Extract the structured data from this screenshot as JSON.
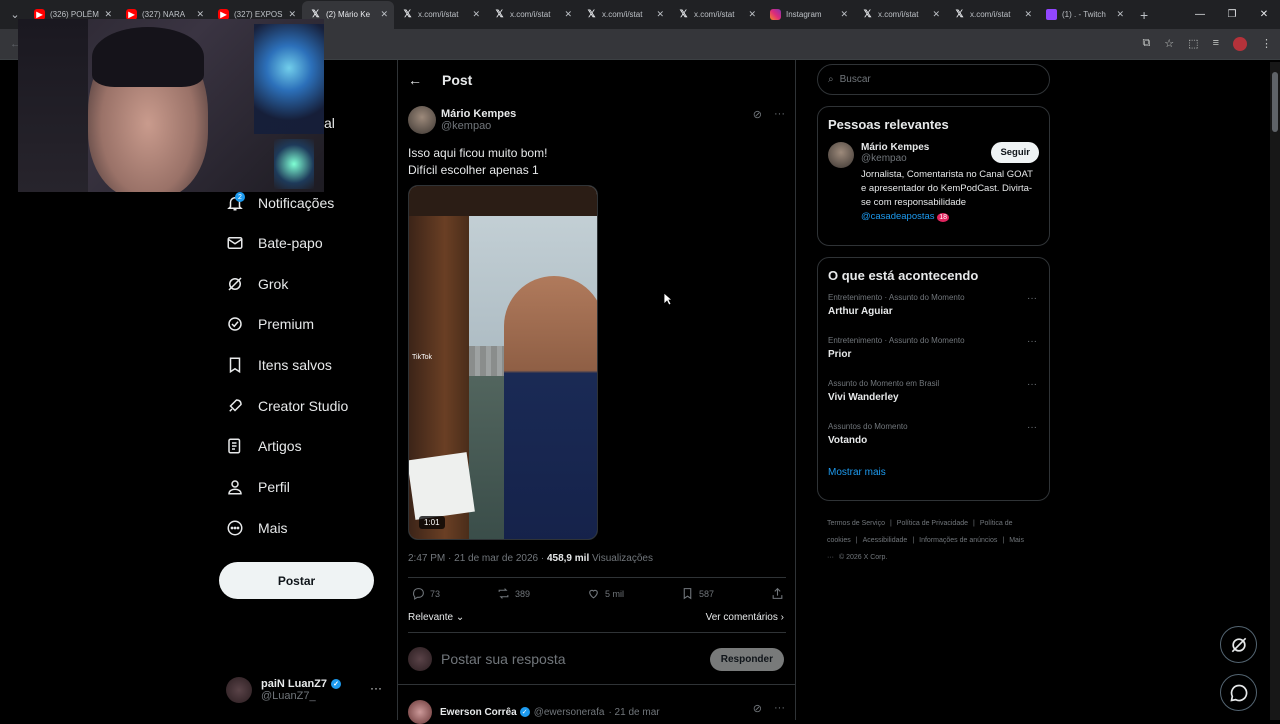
{
  "browser": {
    "tabs": [
      {
        "title": "(326) POLÊM",
        "fav": "yt",
        "active": false
      },
      {
        "title": "(327) NARA",
        "fav": "yt",
        "active": false
      },
      {
        "title": "(327) EXPOS",
        "fav": "yt",
        "active": false
      },
      {
        "title": "(2) Mário Ke",
        "fav": "x",
        "active": true
      },
      {
        "title": "x.com/i/stat",
        "fav": "x",
        "active": false
      },
      {
        "title": "x.com/i/stat",
        "fav": "x",
        "active": false
      },
      {
        "title": "x.com/i/stat",
        "fav": "x",
        "active": false
      },
      {
        "title": "x.com/i/stat",
        "fav": "x",
        "active": false
      },
      {
        "title": "Instagram",
        "fav": "ig",
        "active": false
      },
      {
        "title": "x.com/i/stat",
        "fav": "x",
        "active": false
      },
      {
        "title": "x.com/i/stat",
        "fav": "x",
        "active": false
      },
      {
        "title": "(1) . - Twitch",
        "fav": "tw",
        "active": false
      }
    ]
  },
  "nav": {
    "partial_label": "al",
    "notif_count": "2",
    "items": [
      {
        "label": "Notificações",
        "icon": "bell-icon"
      },
      {
        "label": "Bate-papo",
        "icon": "mail-icon"
      },
      {
        "label": "Grok",
        "icon": "grok-icon"
      },
      {
        "label": "Premium",
        "icon": "premium-icon"
      },
      {
        "label": "Itens salvos",
        "icon": "bookmark-icon"
      },
      {
        "label": "Creator Studio",
        "icon": "rocket-icon"
      },
      {
        "label": "Artigos",
        "icon": "articles-icon"
      },
      {
        "label": "Perfil",
        "icon": "person-icon"
      },
      {
        "label": "Mais",
        "icon": "more-circle-icon"
      }
    ],
    "post_button": "Postar",
    "account": {
      "name": "paiN LuanZ7",
      "handle": "@LuanZ7_"
    }
  },
  "post": {
    "header": "Post",
    "author": {
      "name": "Mário Kempes",
      "handle": "@kempao"
    },
    "text_line1": "Isso aqui ficou muito bom!",
    "text_line2": "Difícil escolher apenas 1",
    "media": {
      "duration": "1:01",
      "watermark": "TikTok"
    },
    "meta_time": "2:47 PM · 21 de mar de 2026 · ",
    "meta_views": "458,9 mil",
    "meta_views_label": " Visualizações",
    "actions": {
      "replies": "73",
      "reposts": "389",
      "likes": "5 mil",
      "bookmarks": "587"
    },
    "sort_label": "Relevante",
    "comments_link": "Ver comentários",
    "reply_placeholder": "Postar sua resposta",
    "reply_button": "Responder",
    "comment": {
      "name": "Ewerson Corrêa",
      "handle": "@ewersonerafa",
      "date": "· 21 de mar"
    }
  },
  "sidebar": {
    "search_placeholder": "Buscar",
    "relevant_title": "Pessoas relevantes",
    "relevant": {
      "name": "Mário Kempes",
      "handle": "@kempao",
      "follow": "Seguir",
      "bio": "Jornalista, Comentarista no Canal GOAT e apresentador do KemPodCast. Divirta-se com responsabilidade ",
      "bio_link": "@casadeapostas",
      "bio_age": "18"
    },
    "trends_title": "O que está acontecendo",
    "trends": [
      {
        "category": "Entretenimento · Assunto do Momento",
        "title": "Arthur Aguiar"
      },
      {
        "category": "Entretenimento · Assunto do Momento",
        "title": "Prior"
      },
      {
        "category": "Assunto do Momento em Brasil",
        "title": "Vivi Wanderley"
      },
      {
        "category": "Assuntos do Momento",
        "title": "Votando"
      }
    ],
    "show_more": "Mostrar mais",
    "footer": [
      "Termos de Serviço",
      "|",
      "Política de Privacidade",
      "|",
      "Política de cookies",
      "|",
      "Acessibilidade",
      "|",
      "Informações de anúncios",
      "|",
      "Mais ···",
      "© 2026 X Corp."
    ]
  }
}
